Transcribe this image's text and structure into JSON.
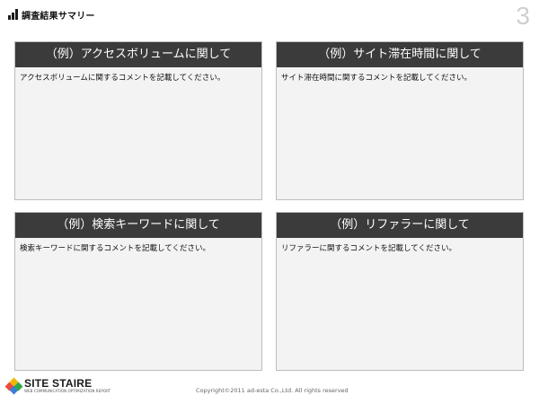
{
  "header": {
    "title": "調査結果サマリー"
  },
  "page_number": "3",
  "panels": [
    {
      "title": "（例）アクセスボリュームに関して",
      "body": "アクセスボリュームに関するコメントを記載してください。"
    },
    {
      "title": "（例）サイト滞在時間に関して",
      "body": "サイト滞在時間に関するコメントを記載してください。"
    },
    {
      "title": "（例）検索キーワードに関して",
      "body": "検索キーワードに関するコメントを記載してください。"
    },
    {
      "title": "（例）リファラーに関して",
      "body": "リファラーに関するコメントを記載してください。"
    }
  ],
  "footer": {
    "logo_name": "SITE STAIRE",
    "logo_tagline": "WEB COMMUNICATION OPTIMIZATION REPORT",
    "copyright": "Copyright©2011 ad-esta Co.,Ltd. All rights reserved"
  },
  "colors": {
    "panel_header": "#3b3b3b",
    "panel_body": "#f3f3f3",
    "page_number": "#cfcfcf"
  },
  "icons": {
    "header_icon": "bar-chart-icon",
    "logo_icon": "diamond-logo-icon"
  }
}
